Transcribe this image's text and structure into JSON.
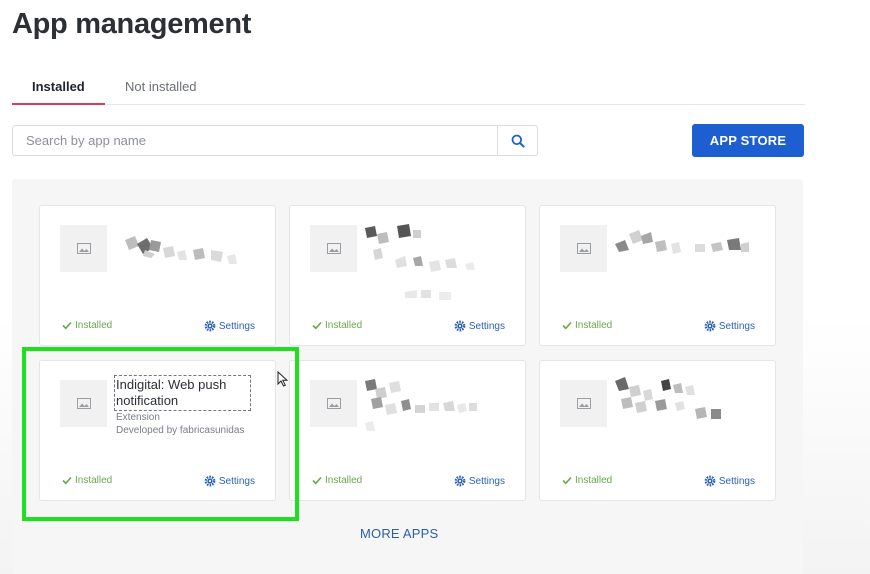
{
  "page": {
    "title": "App management"
  },
  "tabs": [
    {
      "label": "Installed",
      "active": true
    },
    {
      "label": "Not installed",
      "active": false
    }
  ],
  "search": {
    "placeholder": "Search by app name",
    "value": ""
  },
  "toolbar": {
    "app_store_label": "APP STORE"
  },
  "cards": [
    {
      "redacted": true,
      "status": "Installed",
      "settings_label": "Settings"
    },
    {
      "redacted": true,
      "status": "Installed",
      "settings_label": "Settings"
    },
    {
      "redacted": true,
      "status": "Installed",
      "settings_label": "Settings"
    },
    {
      "redacted": false,
      "name": "Indigital: Web push notification",
      "type": "Extension",
      "developer": "Developed by fabricasunidas",
      "status": "Installed",
      "settings_label": "Settings"
    },
    {
      "redacted": true,
      "status": "Installed",
      "settings_label": "Settings"
    },
    {
      "redacted": true,
      "status": "Installed",
      "settings_label": "Settings"
    }
  ],
  "footer": {
    "more_apps_label": "MORE APPS"
  },
  "colors": {
    "accent": "#1d5fd1",
    "tab_underline": "#d93b5e",
    "installed_green": "#6aa84f",
    "highlight": "#1fe01f"
  },
  "icons": {
    "search": "search-icon",
    "thumbnail": "image-placeholder-icon",
    "status": "check-icon",
    "settings": "gear-icon",
    "pointer": "mouse-cursor-icon"
  }
}
